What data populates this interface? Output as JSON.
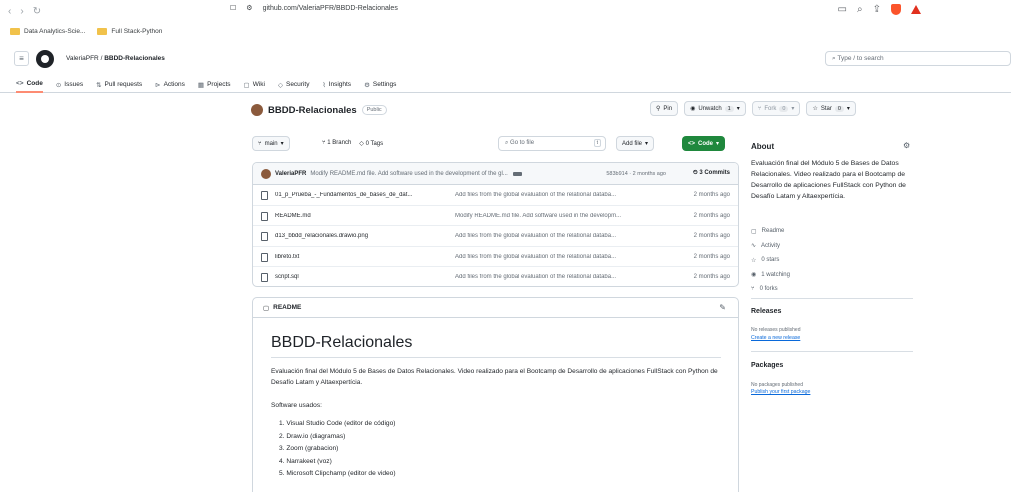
{
  "browser": {
    "url": "github.com/ValeriaPFR/BBDD-Relacionales",
    "bookmarks": [
      "Data Analytics-Scie...",
      "Full Stack-Python"
    ]
  },
  "header": {
    "owner": "ValeriaPFR",
    "separator": "/",
    "repo": "BBDD-Relacionales",
    "search_placeholder": "Type / to search"
  },
  "repo_nav": [
    {
      "label": "Code",
      "icon": "code-icon"
    },
    {
      "label": "Issues",
      "icon": "issue-icon"
    },
    {
      "label": "Pull requests",
      "icon": "pull-request-icon"
    },
    {
      "label": "Actions",
      "icon": "actions-icon"
    },
    {
      "label": "Projects",
      "icon": "projects-icon"
    },
    {
      "label": "Wiki",
      "icon": "wiki-icon"
    },
    {
      "label": "Security",
      "icon": "shield-icon"
    },
    {
      "label": "Insights",
      "icon": "insights-icon"
    },
    {
      "label": "Settings",
      "icon": "gear-icon"
    }
  ],
  "repo_title": {
    "name": "BBDD-Relacionales",
    "visibility": "Public",
    "pin": "Pin",
    "unwatch": "Unwatch",
    "unwatch_count": "1",
    "fork": "Fork",
    "fork_count": "0",
    "star": "Star",
    "star_count": "0"
  },
  "branch_bar": {
    "branch": "main",
    "branches": "1 Branch",
    "tags": "0 Tags",
    "goto_placeholder": "Go to file",
    "goto_key": "t",
    "add_file": "Add file",
    "code": "Code"
  },
  "commit": {
    "author": "ValeriaPFR",
    "message": "Modify README.md file. Add software used in the development of the gl...",
    "meta": "583b914 · 2 months ago",
    "count": "3 Commits"
  },
  "files": [
    {
      "name": "01_p_Prueba_-_Fundamentos_de_bases_de_dat...",
      "message": "Add files from the global evaluation of the relational databa...",
      "date": "2 months ago"
    },
    {
      "name": "README.md",
      "message": "Modify README.md file. Add software used in the developm...",
      "date": "2 months ago"
    },
    {
      "name": "d13_bbdd_relacionales.drawio.png",
      "message": "Add files from the global evaluation of the relational databa...",
      "date": "2 months ago"
    },
    {
      "name": "libreto.txt",
      "message": "Add files from the global evaluation of the relational databa...",
      "date": "2 months ago"
    },
    {
      "name": "script.sql",
      "message": "Add files from the global evaluation of the relational databa...",
      "date": "2 months ago"
    }
  ],
  "readme": {
    "header": "README",
    "title": "BBDD-Relacionales",
    "description": "Evaluación final del Módulo 5 de Bases de Datos Relacionales. Video realizado para el Bootcamp de Desarrollo de aplicaciones FullStack con Python de Desafío Latam y Altaexpertícia.",
    "software_heading": "Software usados:",
    "software": [
      "1. Visual Studio Code (editor de código)",
      "2. Draw.io (diagramas)",
      "3. Zoom (grabacion)",
      "4. Narrakeet (voz)",
      "5. Microsoft Clipchamp (editor de video)"
    ]
  },
  "about": {
    "title": "About",
    "description": "Evaluación final del Módulo 5 de Bases de Datos Relacionales. Video realizado para el Bootcamp de Desarrollo de aplicaciones FullStack con Python de Desafío Latam y Altaexpertícia.",
    "links": [
      {
        "label": "Readme",
        "icon": "book-icon"
      },
      {
        "label": "Activity",
        "icon": "pulse-icon"
      },
      {
        "label": "0 stars",
        "icon": "star-icon"
      },
      {
        "label": "1 watching",
        "icon": "eye-icon"
      },
      {
        "label": "0 forks",
        "icon": "fork-icon"
      }
    ]
  },
  "releases": {
    "title": "Releases",
    "empty": "No releases published",
    "link": "Create a new release"
  },
  "packages": {
    "title": "Packages",
    "empty": "No packages published",
    "link": "Publish your first package"
  }
}
